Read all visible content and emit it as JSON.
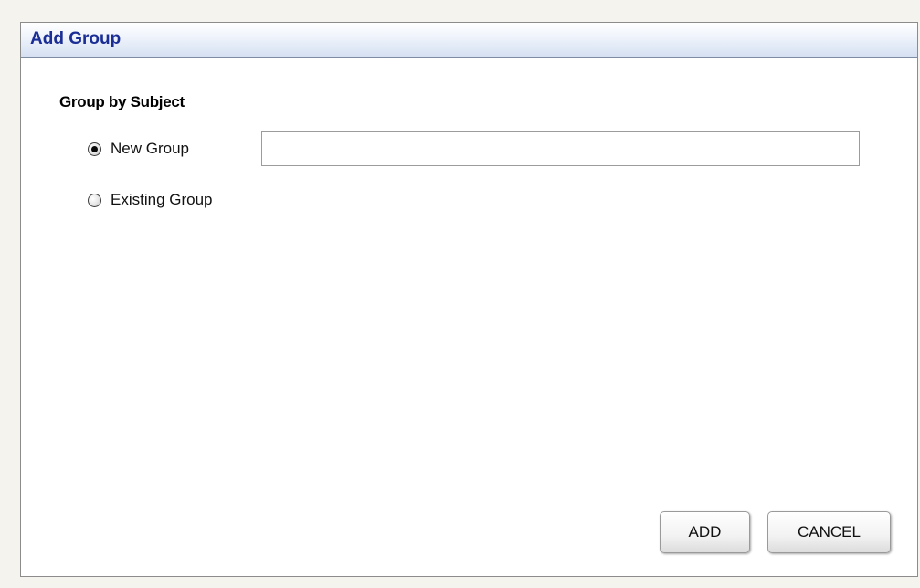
{
  "dialog": {
    "title": "Add Group"
  },
  "form": {
    "section_heading": "Group by Subject",
    "options": [
      {
        "label": "New Group",
        "selected": true
      },
      {
        "label": "Existing Group",
        "selected": false
      }
    ],
    "new_group_input": {
      "value": "",
      "placeholder": ""
    }
  },
  "footer": {
    "add_label": "ADD",
    "cancel_label": "CANCEL"
  },
  "colors": {
    "title_text": "#1a2e96",
    "page_background": "#f4f3ee"
  }
}
